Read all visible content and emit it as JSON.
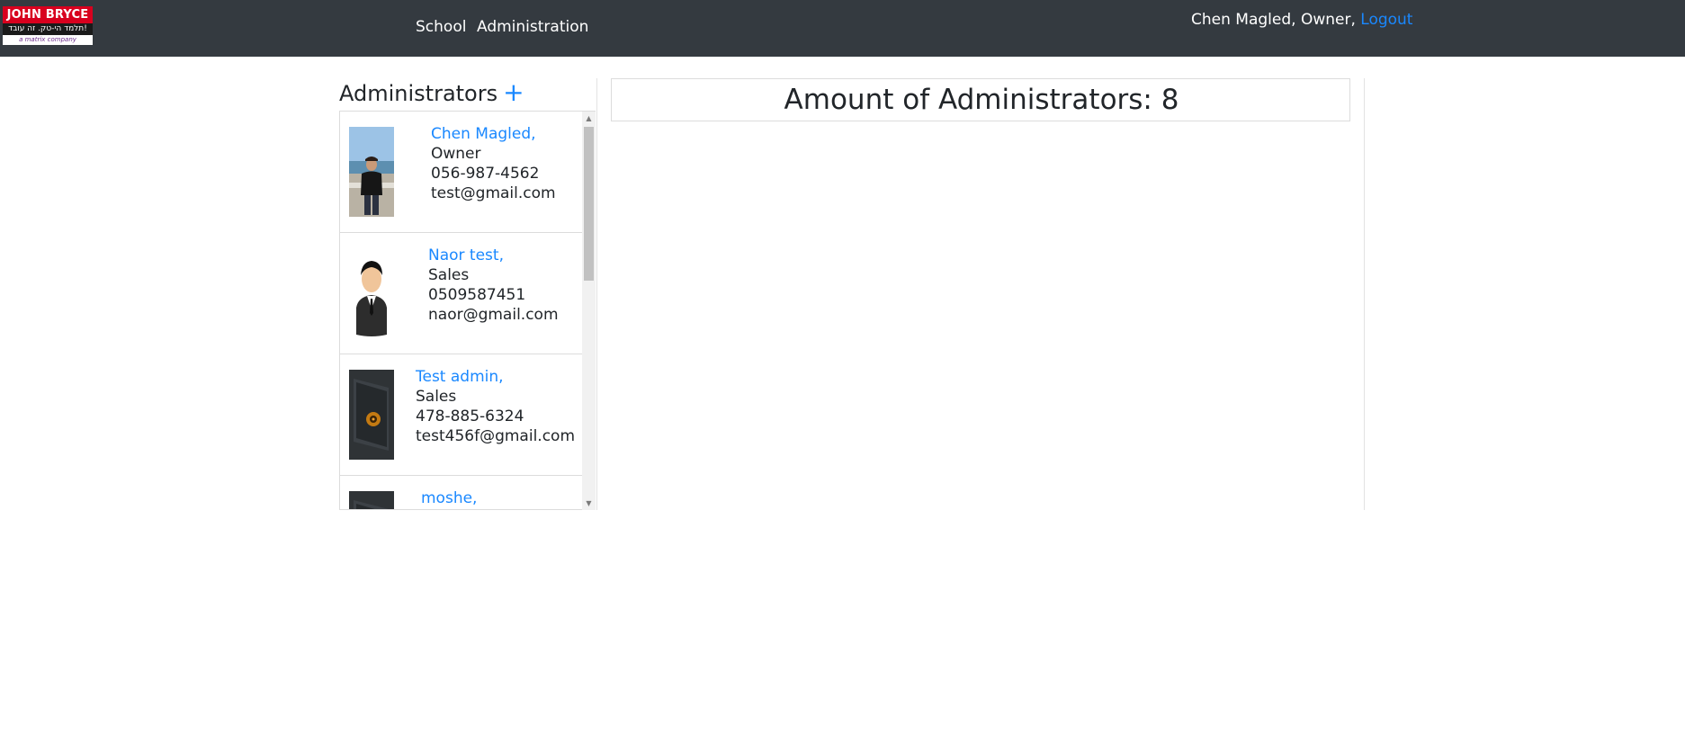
{
  "brand": {
    "logo_top": "JOHN BRYCE",
    "logo_mid": "תלמד הי-טק. זה עובד!",
    "logo_bot": "a matrix company"
  },
  "nav": {
    "links": [
      "School",
      "Administration"
    ],
    "user_text": "Chen Magled, Owner, ",
    "logout": "Logout"
  },
  "sidebar": {
    "title": "Administrators",
    "add": "+",
    "admins": [
      {
        "name": "Chen Magled,",
        "role": "Owner",
        "phone": "056-987-4562",
        "email": "test@gmail.com",
        "avatar": "photo-person-beach"
      },
      {
        "name": "Naor test,",
        "role": "Sales",
        "phone": "0509587451",
        "email": "naor@gmail.com",
        "avatar": "businessman-icon"
      },
      {
        "name": "Test admin,",
        "role": "Sales",
        "phone": "478-885-6324",
        "email": "test456f@gmail.com",
        "avatar": "dark-device-image"
      },
      {
        "name": "moshe,",
        "role": "",
        "phone": "",
        "email": "",
        "avatar": "dark-device-image"
      }
    ]
  },
  "main": {
    "amount_text": "Amount of Administrators: 8"
  },
  "colors": {
    "navbar": "#343a40",
    "link": "#1a88ff",
    "logo_red": "#d8001e"
  }
}
